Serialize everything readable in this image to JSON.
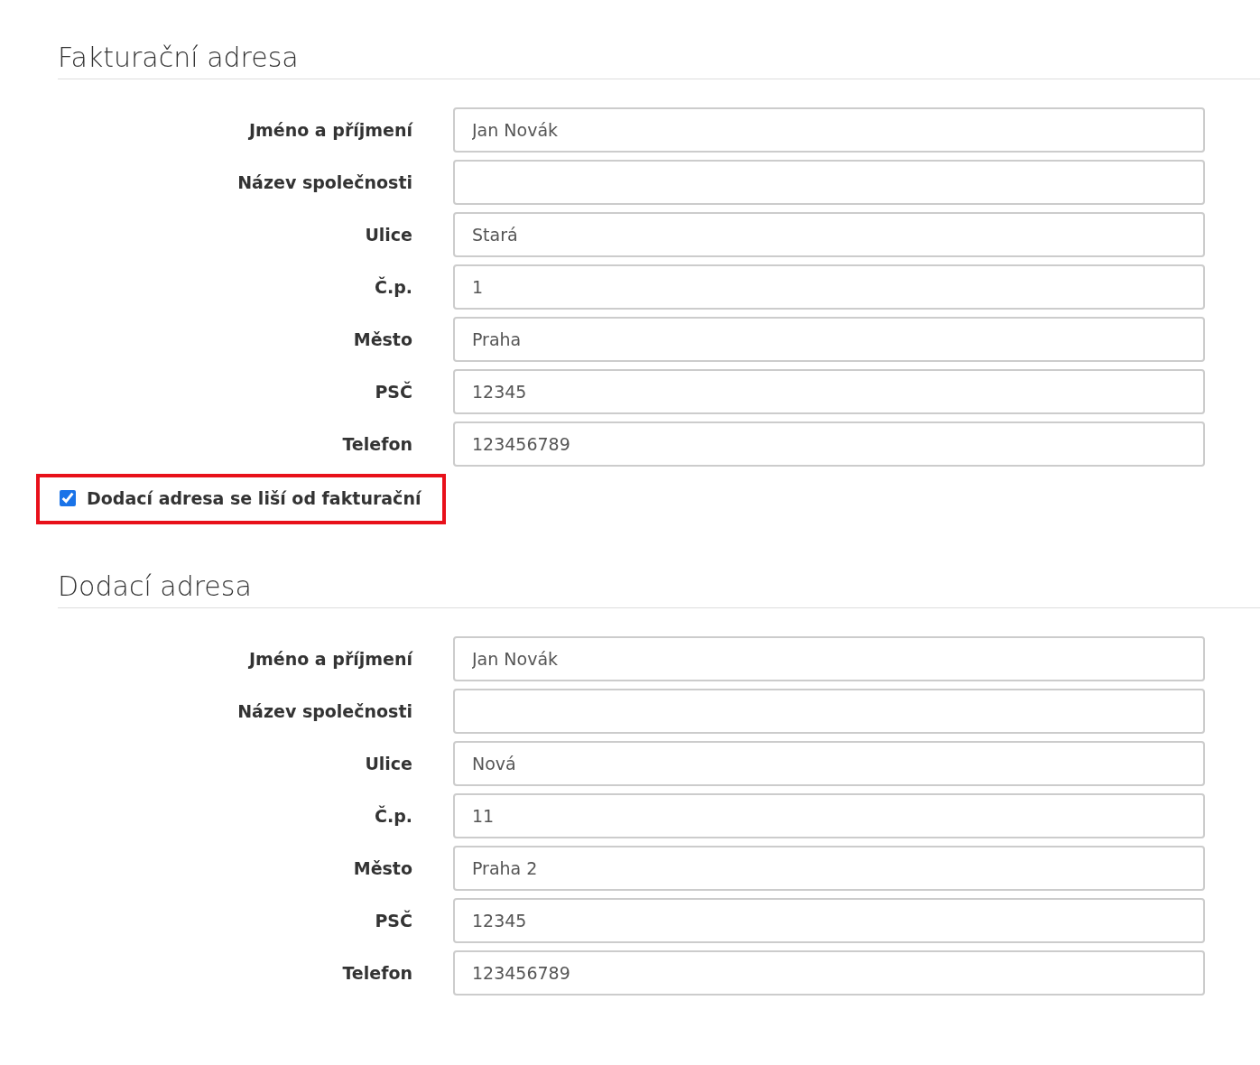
{
  "sections": [
    {
      "title": "Fakturační adresa",
      "fields": [
        {
          "label": "Jméno a příjmení",
          "value": "Jan Novák"
        },
        {
          "label": "Název společnosti"
        },
        {
          "label": "Ulice",
          "value": "Stará"
        },
        {
          "label": "Č.p.",
          "value": "1"
        },
        {
          "label": "Město",
          "value": "Praha"
        },
        {
          "label": "PSČ",
          "value": "12345"
        },
        {
          "label": "Telefon",
          "value": "123456789"
        }
      ],
      "checkbox": {
        "label": "Dodací adresa se liší od fakturační",
        "checked": true,
        "highlighted": true
      }
    },
    {
      "title": "Dodací adresa",
      "fields": [
        {
          "label": "Jméno a příjmení",
          "value": "Jan Novák"
        },
        {
          "label": "Název společnosti"
        },
        {
          "label": "Ulice",
          "value": "Nová"
        },
        {
          "label": "Č.p.",
          "value": "11"
        },
        {
          "label": "Město",
          "value": "Praha 2"
        },
        {
          "label": "PSČ",
          "value": "12345"
        },
        {
          "label": "Telefon",
          "value": "123456789"
        }
      ]
    }
  ]
}
